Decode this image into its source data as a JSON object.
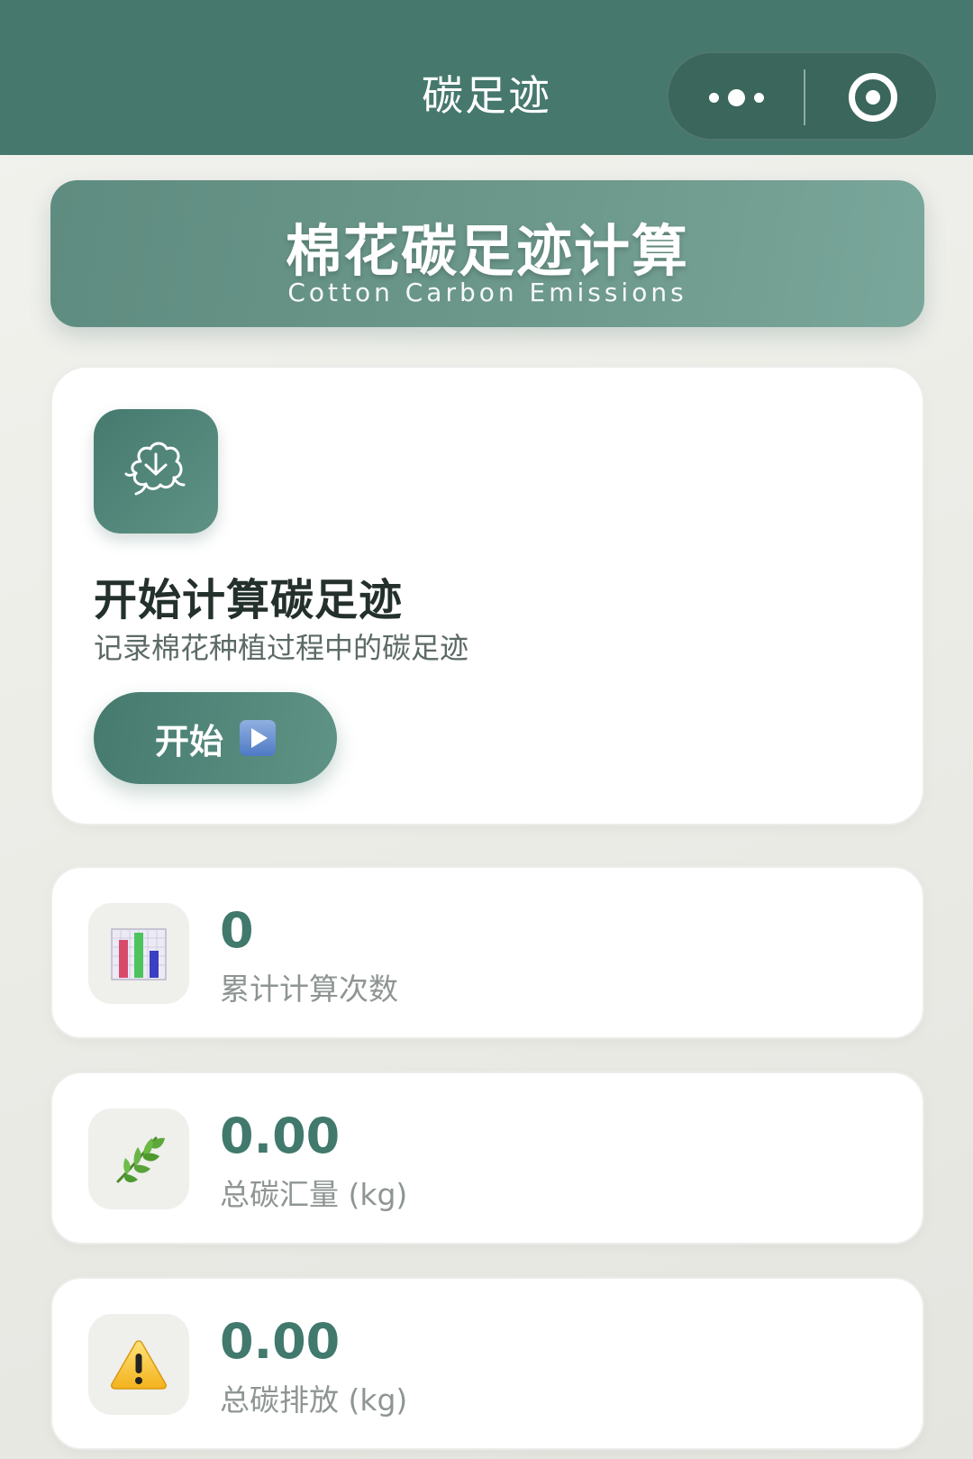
{
  "topbar": {
    "title": "碳足迹",
    "more_icon": "more-dots-icon",
    "close_icon": "target-close-icon"
  },
  "banner": {
    "title": "棉花碳足迹计算",
    "subtitle": "Cotton Carbon Emissions"
  },
  "start_card": {
    "icon": "cotton-boll-icon",
    "title": "开始计算碳足迹",
    "description": "记录棉花种植过程中的碳足迹",
    "button_label": "开始",
    "button_icon": "play-button-icon"
  },
  "stats": [
    {
      "icon": "bar-chart-icon",
      "value": "0",
      "label": "累计计算次数"
    },
    {
      "icon": "herb-leaf-icon",
      "value": "0.00",
      "label": "总碳汇量 (kg)"
    },
    {
      "icon": "warning-icon",
      "value": "0.00",
      "label": "总碳排放 (kg)"
    }
  ],
  "colors": {
    "primary": "#46786d",
    "accent_text": "#41796c",
    "card_bg": "#ffffff",
    "page_bg": "#efefea"
  }
}
